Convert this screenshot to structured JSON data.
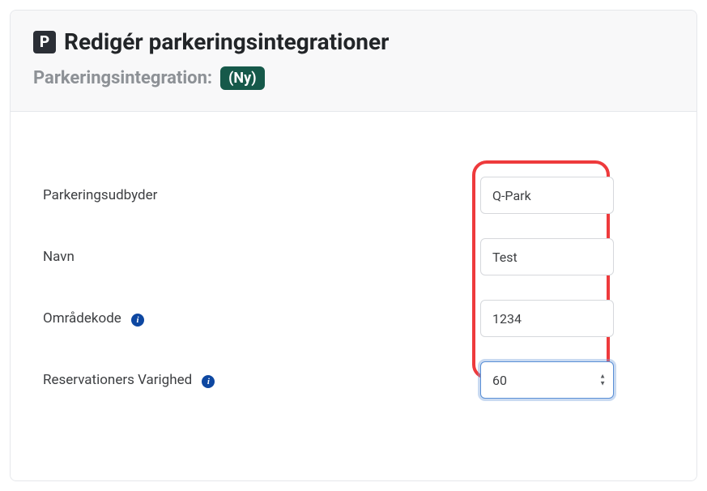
{
  "header": {
    "icon_label": "P",
    "title": "Redigér parkeringsintegrationer",
    "subtitle": "Parkeringsintegration:",
    "badge": "(Ny)"
  },
  "form": {
    "provider": {
      "label": "Parkeringsudbyder",
      "value": "Q-Park"
    },
    "name": {
      "label": "Navn",
      "value": "Test"
    },
    "area_code": {
      "label": "Områdekode",
      "value": "1234"
    },
    "duration": {
      "label": "Reservationers Varighed",
      "value": "60"
    }
  }
}
